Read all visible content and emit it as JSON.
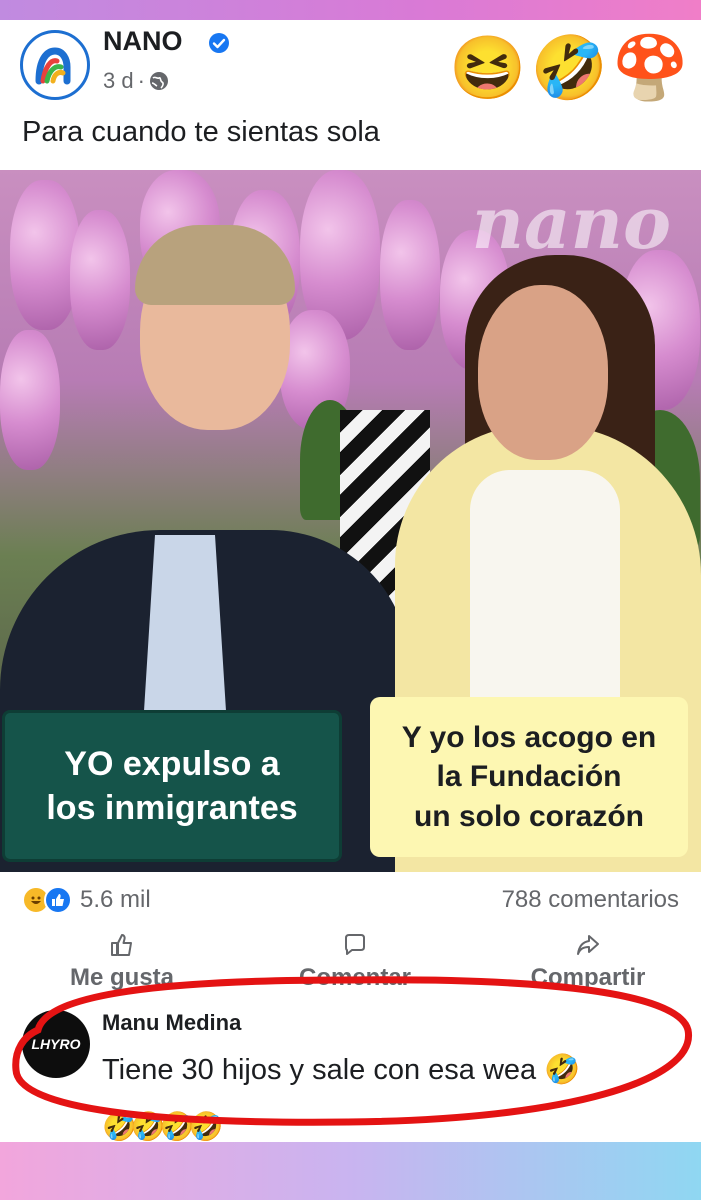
{
  "post": {
    "page_name": "NANO",
    "time_ago": "3 d",
    "caption": "Para cuando te sientas sola",
    "header_emojis": [
      "😆",
      "🤣",
      "🍄"
    ]
  },
  "media": {
    "watermark": "nano",
    "overlay_left": {
      "line1": "YO expulso a",
      "line2": "los inmigrantes"
    },
    "overlay_right": {
      "line1": "Y yo los acogo en",
      "line2": "la Fundación",
      "line3": "un solo corazón"
    }
  },
  "stats": {
    "reactions_count": "5.6 mil",
    "comments_count": "788 comentarios"
  },
  "actions": {
    "like_label": "Me gusta",
    "comment_label": "Comentar",
    "share_label": "Compartir"
  },
  "comment": {
    "author": "Manu Medina",
    "avatar_text": "LHYRO",
    "text": "Tiene 30 hijos y sale con esa wea 🤣",
    "emojis": "🤣🤣🤣🤣"
  },
  "colors": {
    "accent_blue": "#1877f2",
    "highlight_red": "#e41313",
    "overlay_green": "#15544a",
    "overlay_yellow": "#fdf7b2"
  }
}
